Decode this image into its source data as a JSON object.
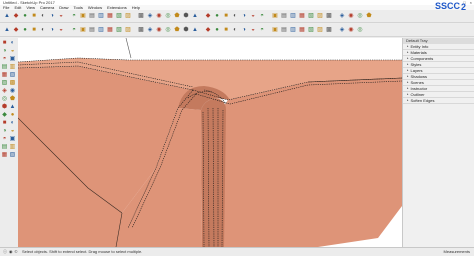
{
  "app": {
    "title": "Untitled - SketchUp Pro 2017",
    "window_controls": [
      "–",
      "□",
      "×"
    ]
  },
  "menu": [
    "File",
    "Edit",
    "View",
    "Camera",
    "Draw",
    "Tools",
    "Window",
    "Extensions",
    "Help"
  ],
  "toolbar_row1": [
    "arrow-cursor-icon",
    "eraser-icon",
    "paint-bucket-icon",
    "pencil-icon",
    "rectangle-icon",
    "circle-icon",
    "arc-icon",
    "push-pull-icon",
    "move-icon",
    "rotate-icon",
    "scale-icon",
    "offset-icon",
    "tape-measure-icon",
    "text-icon",
    "orbit-icon",
    "pan-icon",
    "zoom-icon",
    "zoom-extents-icon",
    "section-plane-icon",
    "iso-view-icon",
    "top-view-icon",
    "front-view-icon",
    "right-view-icon",
    "back-view-icon",
    "left-view-icon",
    "xray-icon",
    "wireframe-icon",
    "hidden-line-icon",
    "shaded-icon",
    "textured-icon",
    "monochrome-icon",
    "warehouse-icon",
    "extension-icon",
    "layer-icon",
    "tag-icon",
    "shadow-icon",
    "fog-icon",
    "style-icon",
    "scene-icon"
  ],
  "toolbar_row2": [
    "vertex-tools-icon",
    "curviloft-icon",
    "joint-push-pull-icon",
    "round-corner-icon",
    "fredo-scale-icon",
    "bezier-spline-icon",
    "line-icon",
    "curve-icon",
    "sphere-icon",
    "cone-icon",
    "cylinder-icon",
    "torus-icon",
    "extrude-icon",
    "follow-me-icon",
    "intersect-icon",
    "solid-union-icon",
    "solid-subtract-icon",
    "trim-icon",
    "split-icon",
    "outer-shell-icon",
    "weld-icon",
    "explode-icon",
    "group-icon",
    "component-icon",
    "dimension-icon",
    "protractor-icon",
    "axes-icon",
    "3d-text-icon",
    "previous-view-icon",
    "next-view-icon",
    "walk-icon",
    "look-around-icon",
    "position-camera-icon",
    "match-photo-icon",
    "sandbox-icon",
    "smoove-icon",
    "stamp-icon",
    "drape-icon"
  ],
  "logo": {
    "letters": "SSCC",
    "suffix": "2",
    "color": "#1f58c9"
  },
  "left_tools": [
    "select-tool-icon",
    "eraser-tool-icon",
    "line-tool-icon",
    "freehand-tool-icon",
    "rectangle-tool-icon",
    "circle-tool-icon",
    "polygon-tool-icon",
    "arc-tool-icon",
    "move-tool-icon",
    "push-pull-tool-icon",
    "rotate-tool-icon",
    "follow-me-tool-icon",
    "scale-tool-icon",
    "offset-tool-icon",
    "tape-tool-icon",
    "dimension-tool-icon",
    "protractor-tool-icon",
    "text-tool-icon",
    "axes-tool-icon",
    "3d-text-tool-icon",
    "paint-tool-icon",
    "orbit-tool-icon",
    "pan-tool-icon",
    "zoom-tool-icon",
    "zoom-window-tool-icon",
    "zoom-extents-tool-icon",
    "walk-tool-icon",
    "look-around-tool-icon",
    "section-tool-icon",
    "warehouse-tool-icon"
  ],
  "tray": {
    "header": "Default Tray",
    "items": [
      "Entity Info",
      "Materials",
      "Components",
      "Styles",
      "Layers",
      "Shadows",
      "Scenes",
      "Instructor",
      "Outliner",
      "Soften Edges"
    ]
  },
  "status": {
    "message": "Select objects. Shift to extend select. Drag mouse to select multiple.",
    "measurements_label": "Measurements"
  },
  "colors": {
    "model_face": "#de9478",
    "model_face_dark": "#c47a5e",
    "model_top": "#e7a488",
    "edge": "#1a1a1a",
    "viewport_bg": "#ffffff",
    "ui_bg": "#ececec"
  }
}
